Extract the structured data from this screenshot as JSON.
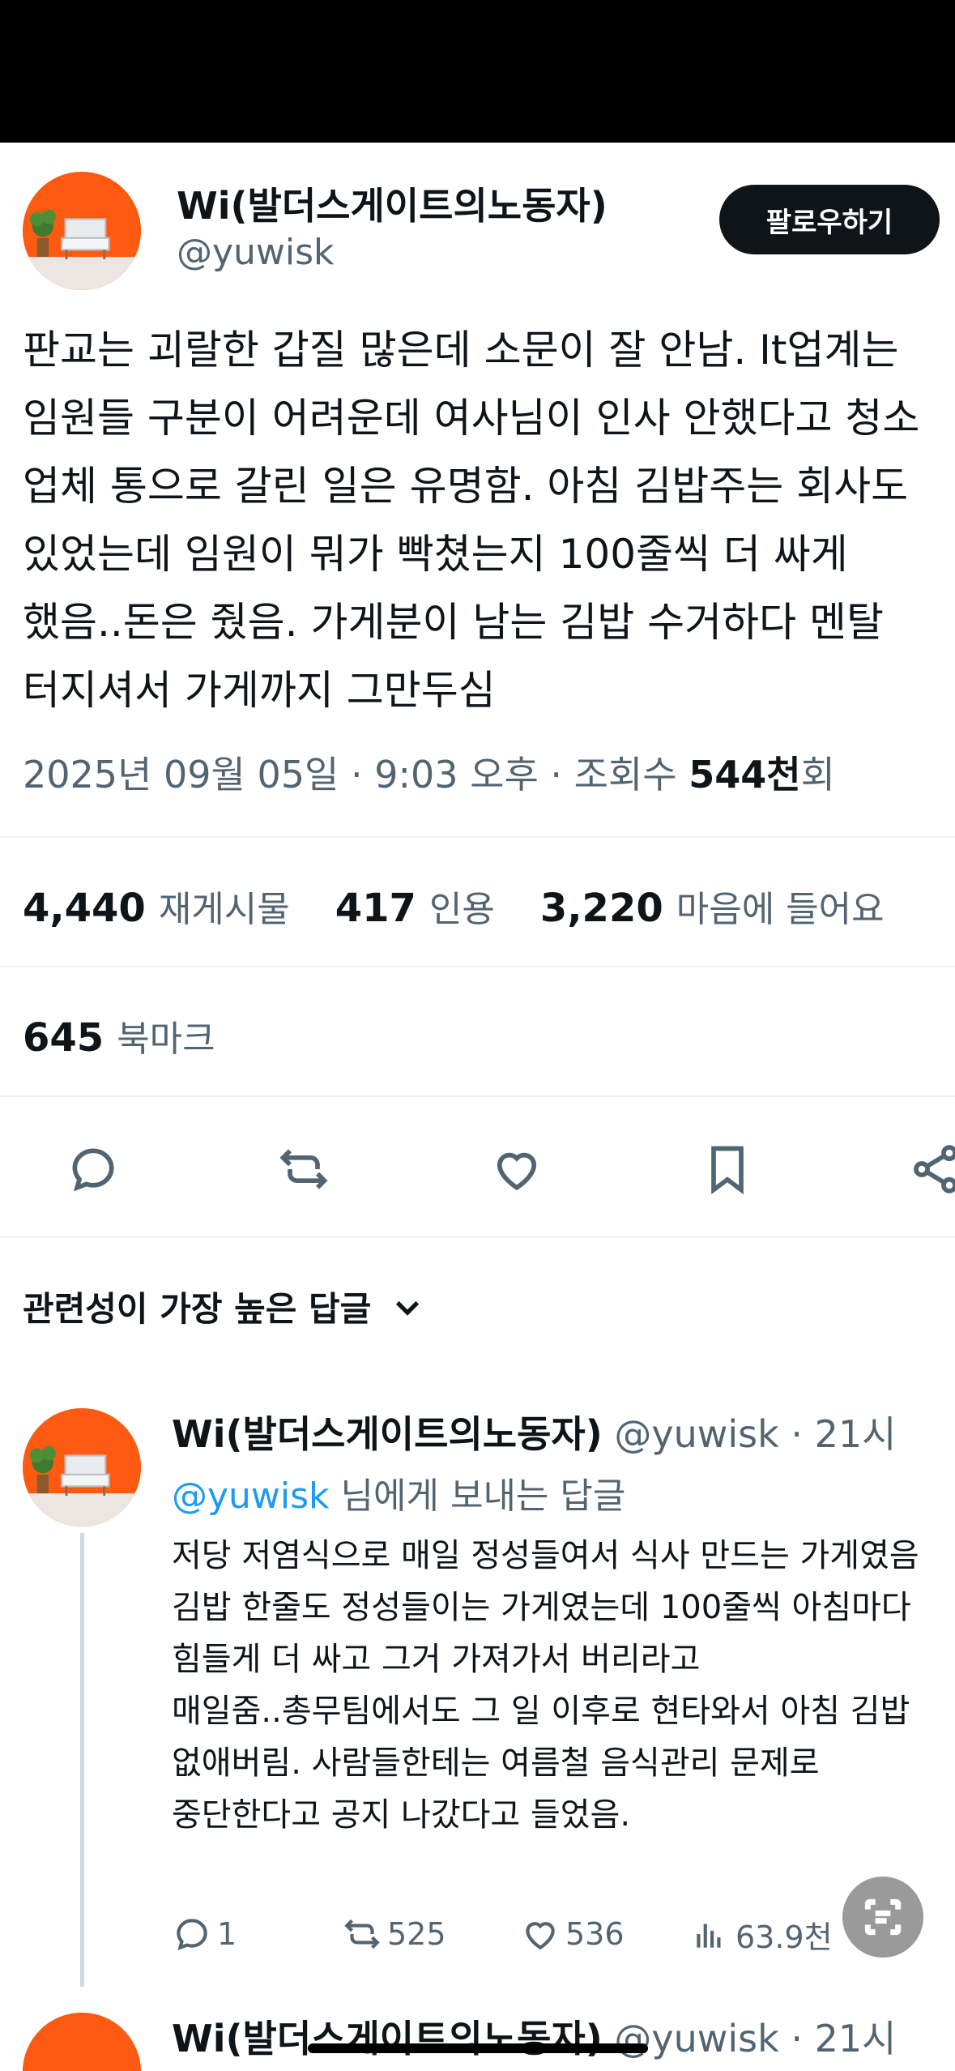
{
  "tweet": {
    "author_name": "Wi(발더스게이트의노동자)",
    "author_handle": "@yuwisk",
    "follow_label": "팔로우하기",
    "body_lines": [
      "판교는 괴랄한 갑질 많은데 소문이 잘 안남. It업계는",
      "임원들 구분이 어려운데 여사님이 인사 안했다고 청소",
      "업체 통으로 갈린 일은 유명함. 아침 김밥주는 회사도",
      "있었는데 임원이 뭐가 빡쳤는지 100줄씩 더 싸게",
      "했음..돈은 줬음. 가게분이 남는 김밥 수거하다 멘탈",
      "터지셔서 가게까지 그만두심"
    ],
    "timestamp": "2025년 09월 05일 · 9:03 오후 · 조회수 ",
    "views_value": "544천",
    "views_suffix": "회"
  },
  "stats": {
    "reposts_count": "4,440",
    "reposts_label": "재게시물",
    "quotes_count": "417",
    "quotes_label": "인용",
    "likes_count": "3,220",
    "likes_label": "마음에 들어요",
    "bookmarks_count": "645",
    "bookmarks_label": "북마크"
  },
  "sort": {
    "label": "관련성이 가장 높은 답글"
  },
  "reply": {
    "author_name": "Wi(발더스게이트의노동자)",
    "author_handle": "@yuwisk",
    "time": "· 21시",
    "reply_to_mention": "@yuwisk",
    "reply_to_suffix": " 님에게 보내는 답글",
    "body_lines": [
      "저당 저염식으로 매일 정성들여서 식사 만드는 가게였음",
      "김밥 한줄도 정성들이는 가게였는데 100줄씩 아침마다",
      "힘들게 더 싸고 그거 가져가서 버리라고",
      "매일줌..총무팀에서도 그 일 이후로 현타와서 아침 김밥",
      "없애버림. 사람들한테는 여름철 음식관리 문제로",
      "중단한다고 공지 나갔다고 들었음."
    ],
    "replies": "1",
    "reposts": "525",
    "likes": "536",
    "views": "63.9천"
  },
  "reply2": {
    "author_name": "Wi(발더스게이트의노동자)",
    "author_handle": "@yuwisk",
    "time": "· 21시"
  },
  "colors": {
    "accent": "#1d9bf0",
    "muted": "#536471",
    "text": "#0f1419",
    "avatar_bg": "#ff5a12"
  }
}
